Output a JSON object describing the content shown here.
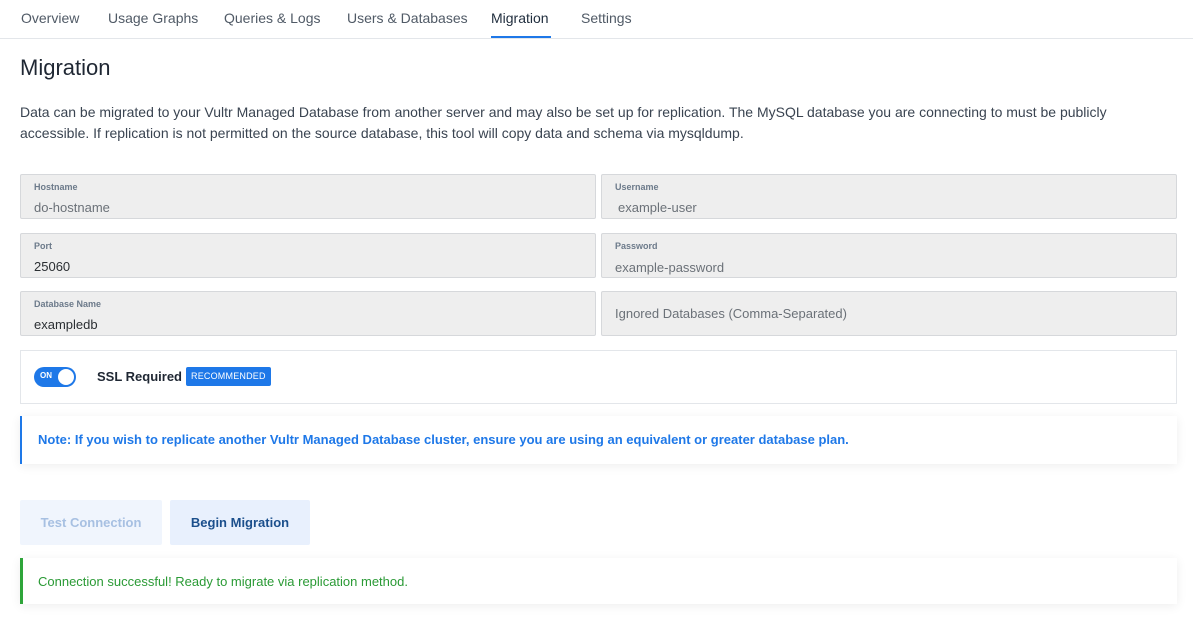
{
  "tabs": [
    {
      "label": "Overview"
    },
    {
      "label": "Usage Graphs"
    },
    {
      "label": "Queries & Logs"
    },
    {
      "label": "Users & Databases"
    },
    {
      "label": "Migration",
      "active": true
    },
    {
      "label": "Settings"
    }
  ],
  "page": {
    "title": "Migration",
    "description": "Data can be migrated to your Vultr Managed Database from another server and may also be set up for replication. The MySQL database you are connecting to must be publicly accessible. If replication is not permitted on the source database, this tool will copy data and schema via mysqldump."
  },
  "form": {
    "hostname": {
      "label": "Hostname",
      "value": "do-hostname"
    },
    "username": {
      "label": "Username",
      "value": "example-user"
    },
    "port": {
      "label": "Port",
      "value": "25060"
    },
    "password": {
      "label": "Password",
      "value": "example-password"
    },
    "database_name": {
      "label": "Database Name",
      "value": "exampledb"
    },
    "ignored_databases": {
      "placeholder": "Ignored Databases (Comma-Separated)"
    }
  },
  "ssl": {
    "toggle_state": "ON",
    "label": "SSL Required",
    "badge": "RECOMMENDED"
  },
  "note": "Note: If you wish to replicate another Vultr Managed Database cluster, ensure you are using an equivalent or greater database plan.",
  "buttons": {
    "test_connection": "Test Connection",
    "begin_migration": "Begin Migration"
  },
  "status_message": "Connection successful! Ready to migrate via replication method.",
  "colors": {
    "accent": "#1e78e8",
    "success": "#2fa53a"
  }
}
